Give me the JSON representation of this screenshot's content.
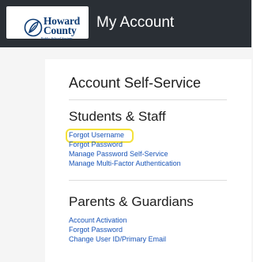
{
  "header": {
    "logo_line1": "Howard",
    "logo_line2": "County",
    "logo_subtitle": "Public School System",
    "title": "My Account"
  },
  "main": {
    "page_heading": "Account Self-Service",
    "students_staff": {
      "heading": "Students & Staff",
      "links": [
        {
          "label": "Forgot Username",
          "highlighted": true
        },
        {
          "label": "Forgot Password"
        },
        {
          "label": "Manage Password Self-Service"
        },
        {
          "label": "Manage Multi-Factor Authentication"
        }
      ]
    },
    "parents_guardians": {
      "heading": "Parents & Guardians",
      "links": [
        {
          "label": "Account Activation"
        },
        {
          "label": "Forgot Password"
        },
        {
          "label": "Change User ID/Primary Email"
        }
      ]
    }
  },
  "colors": {
    "header_bg": "#2a2f35",
    "logo_blue": "#0d3b74",
    "link_blue": "#1a55b8",
    "highlight": "#f4e13a"
  },
  "icons": {
    "logo": "hcpss-leaf-logo-icon"
  }
}
